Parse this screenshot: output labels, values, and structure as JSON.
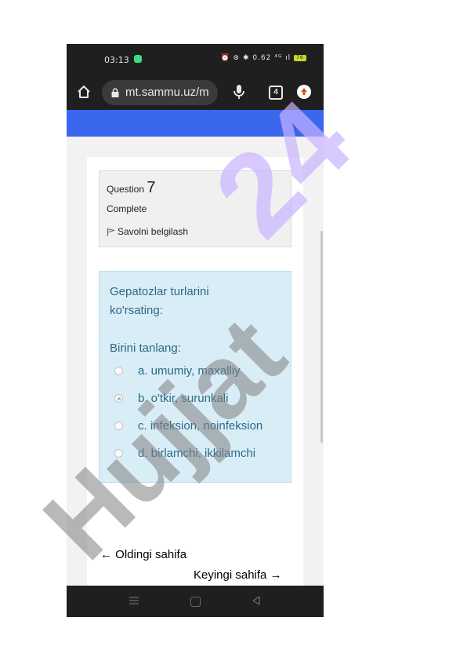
{
  "status_bar": {
    "time": "03:13",
    "right_icons": "⏰ ⊛ ✱ 0.62 ⁴ᴳ ıl",
    "battery": "76"
  },
  "browser": {
    "url": "mt.sammu.uz/m",
    "tab_count": "4"
  },
  "question_info": {
    "label": "Question",
    "number": "7",
    "state": "Complete",
    "flag_label": "Savolni belgilash"
  },
  "question": {
    "text": "Gepatozlar turlarini ko'rsating:",
    "prompt": "Birini tanlang:",
    "options": [
      {
        "label": "a. umumiy, maxalliy",
        "selected": false
      },
      {
        "label": "b. o'tkir, surunkali",
        "selected": true
      },
      {
        "label": "c. infeksion, noinfeksion",
        "selected": false
      },
      {
        "label": "d. birlamchi, ikkilamchi",
        "selected": false
      }
    ]
  },
  "navigation": {
    "prev_label": "Oldingi sahifa",
    "next_label": "Keyingi sahifa"
  },
  "watermark": {
    "text1": "Hujjat",
    "text2": "24",
    "color1": "#808080",
    "color2": "#c8b4ff"
  }
}
